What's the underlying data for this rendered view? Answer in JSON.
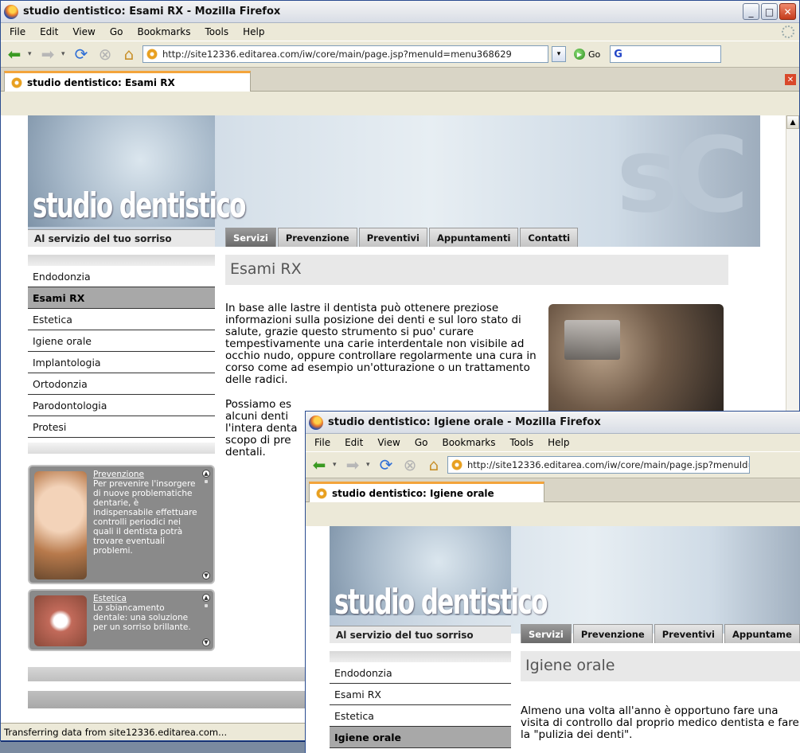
{
  "back_window": {
    "title": "studio dentistico: Esami RX - Mozilla Firefox",
    "menu": [
      "File",
      "Edit",
      "View",
      "Go",
      "Bookmarks",
      "Tools",
      "Help"
    ],
    "url": "http://site12336.editarea.com/iw/core/main/page.jsp?menuId=menu368629",
    "go_label": "Go",
    "tab_title": "studio dentistico: Esami RX",
    "status": "Transferring data from site12336.editarea.com...",
    "logo": "studio dentistico",
    "tagline": "Al servizio del tuo sorriso",
    "nav_tabs": [
      "Servizi",
      "Prevenzione",
      "Preventivi",
      "Appuntamenti",
      "Contatti"
    ],
    "sidebar": [
      "Endodonzia",
      "Esami RX",
      "Estetica",
      "Igiene orale",
      "Implantologia",
      "Ortodonzia",
      "Parodontologia",
      "Protesi"
    ],
    "active_side": "Esami RX",
    "page_title": "Esami RX",
    "paragraph1": "In base alle lastre il dentista può ottenere preziose informazioni sulla posizione dei denti e sul loro stato di salute, grazie questo strumento si puo' curare tempestivamente una carie interdentale non visibile ad occhio nudo, oppure controllare regolarmente una cura in corso come ad esempio un'otturazione o un trattamento delle radici.",
    "paragraph2": "Possiamo es alcuni denti l'intera denta scopo di pre dentali.",
    "promo1": {
      "title": "Prevenzione",
      "text": "Per prevenire l'insorgere di nuove problematiche dentarie, è indispensabile effettuare controlli periodici nei quali il dentista potrà trovare eventuali problemi."
    },
    "promo2": {
      "title": "Estetica",
      "text": "Lo sbiancamento dentale: una soluzione per un sorriso brillante."
    }
  },
  "front_window": {
    "title": "studio dentistico: Igiene orale - Mozilla Firefox",
    "menu": [
      "File",
      "Edit",
      "View",
      "Go",
      "Bookmarks",
      "Tools",
      "Help"
    ],
    "url": "http://site12336.editarea.com/iw/core/main/page.jsp?menuId=",
    "tab_title": "studio dentistico: Igiene orale",
    "logo": "studio dentistico",
    "tagline": "Al servizio del tuo sorriso",
    "nav_tabs": [
      "Servizi",
      "Prevenzione",
      "Preventivi",
      "Appuntame"
    ],
    "sidebar": [
      "Endodonzia",
      "Esami RX",
      "Estetica",
      "Igiene orale"
    ],
    "active_side": "Igiene orale",
    "page_title": "Igiene orale",
    "paragraph1": "Almeno una volta all'anno è opportuno fare una visita di controllo dal proprio medico dentista e fare la \"pulizia dei denti\"."
  }
}
